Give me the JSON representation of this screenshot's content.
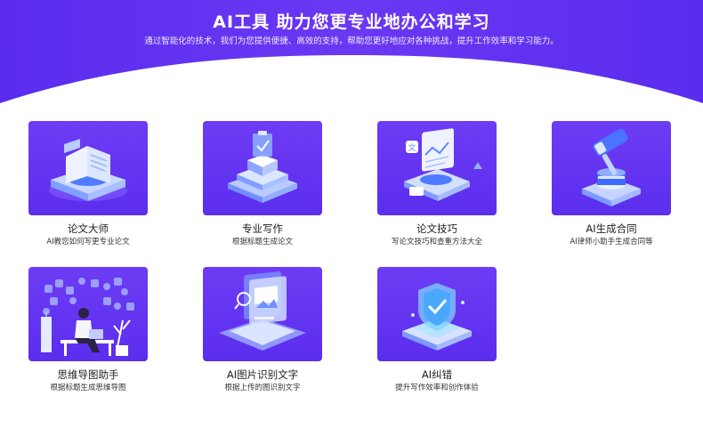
{
  "header": {
    "title": "AI工具 助力您更专业地办公和学习",
    "subtitle": "通过智能化的技术，我们为您提供便捷、高效的支持，帮助您更好地应对各种挑战，提升工作效率和学习能力。"
  },
  "colors": {
    "brand_purple": "#6233f0",
    "card_purple": "#6d3cf4",
    "title_text": "#222222"
  },
  "tools": [
    {
      "name": "论文大师",
      "desc": "AI教您如何写更专业论文",
      "icon": "book-icon"
    },
    {
      "name": "专业写作",
      "desc": "根据标题生成论文",
      "icon": "clipboard-stack-icon"
    },
    {
      "name": "论文技巧",
      "desc": "写论文技巧和查重方法大全",
      "icon": "document-chart-icon"
    },
    {
      "name": "AI生成合同",
      "desc": "AI律师小助手生成合同等",
      "icon": "gavel-icon"
    },
    {
      "name": "思维导图助手",
      "desc": "根据标题生成思维导图",
      "icon": "mindmap-person-icon"
    },
    {
      "name": "AI图片识别文字",
      "desc": "根据上传的图识别文字",
      "icon": "image-scan-icon"
    },
    {
      "name": "AI纠错",
      "desc": "提升写作效率和创作体验",
      "icon": "shield-check-icon"
    }
  ]
}
